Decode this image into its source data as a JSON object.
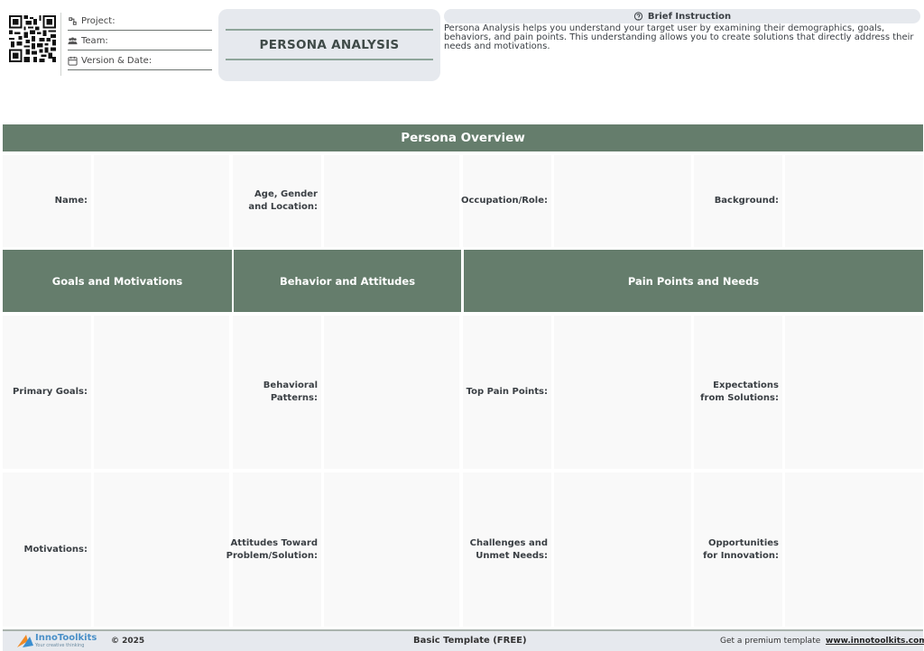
{
  "header": {
    "project_label": "Project:",
    "team_label": "Team:",
    "version_label": "Version & Date:",
    "title": "PERSONA ANALYSIS",
    "instruction_title": "Brief Instruction",
    "instruction_text": "Persona Analysis helps you understand your target user by examining their demographics, goals, behaviors, and pain points. This understanding allows you to create solutions that directly address their needs and motivations."
  },
  "overview": {
    "title": "Persona Overview",
    "fields": [
      "Name:",
      "Age, Gender\nand Location:",
      "Occupation/Role:",
      "Background:"
    ]
  },
  "sections": {
    "goals": "Goals and Motivations",
    "behavior": "Behavior and Attitudes",
    "pain": "Pain Points and Needs"
  },
  "rows": {
    "row1": [
      "Primary Goals:",
      "Behavioral\nPatterns:",
      "Top Pain Points:",
      "Expectations\nfrom Solutions:"
    ],
    "row2": [
      "Motivations:",
      "Attitudes Toward\nProblem/Solution:",
      "Challenges and\nUnmet Needs:",
      "Opportunities\nfor Innovation:"
    ]
  },
  "footer": {
    "brand": "InnoToolkits",
    "tagline": "Your creative thinking",
    "copyright": "© 2025",
    "template": "Basic Template (FREE)",
    "premium": "Get a premium template",
    "site": "www.innotoolkits.com"
  },
  "colors": {
    "band": "#657d6c",
    "title_box": "#e6e9ee",
    "cell": "#f9f9f9"
  },
  "icons": [
    "qr-code-icon",
    "project-icon",
    "team-icon",
    "calendar-icon",
    "instruction-icon",
    "innotoolkits-logo-icon"
  ]
}
